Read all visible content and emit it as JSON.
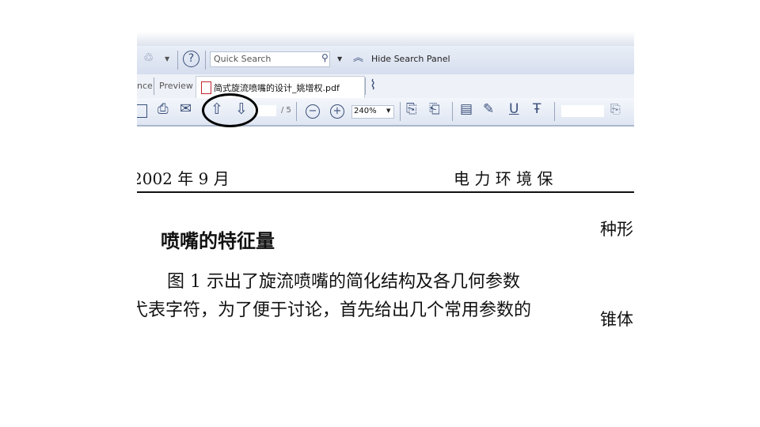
{
  "search_panel": {
    "placeholder": "Quick Search",
    "hide_label": "Hide Search Panel"
  },
  "tabs": [
    {
      "label": "nce"
    },
    {
      "label": "Preview"
    },
    {
      "label": "简式旋流喷嘴的设计_姚增权.pdf"
    }
  ],
  "toolbar": {
    "page_total": "/ 5",
    "zoom": "240%"
  },
  "document": {
    "header_left": "2002 年 9 月",
    "header_right": "电 力 环 境 保",
    "section_title": "喷嘴的特征量",
    "line1": "图 1 示出了旋流喷嘴的简化结构及各几何参数",
    "line2": "弋表字符，为了便于讨论，首先给出几个常用参数的",
    "right_col_1": "种形",
    "right_col_2": "锥体"
  },
  "colors": {
    "accent": "#3a4f7a",
    "highlight_circle": "#000000"
  }
}
